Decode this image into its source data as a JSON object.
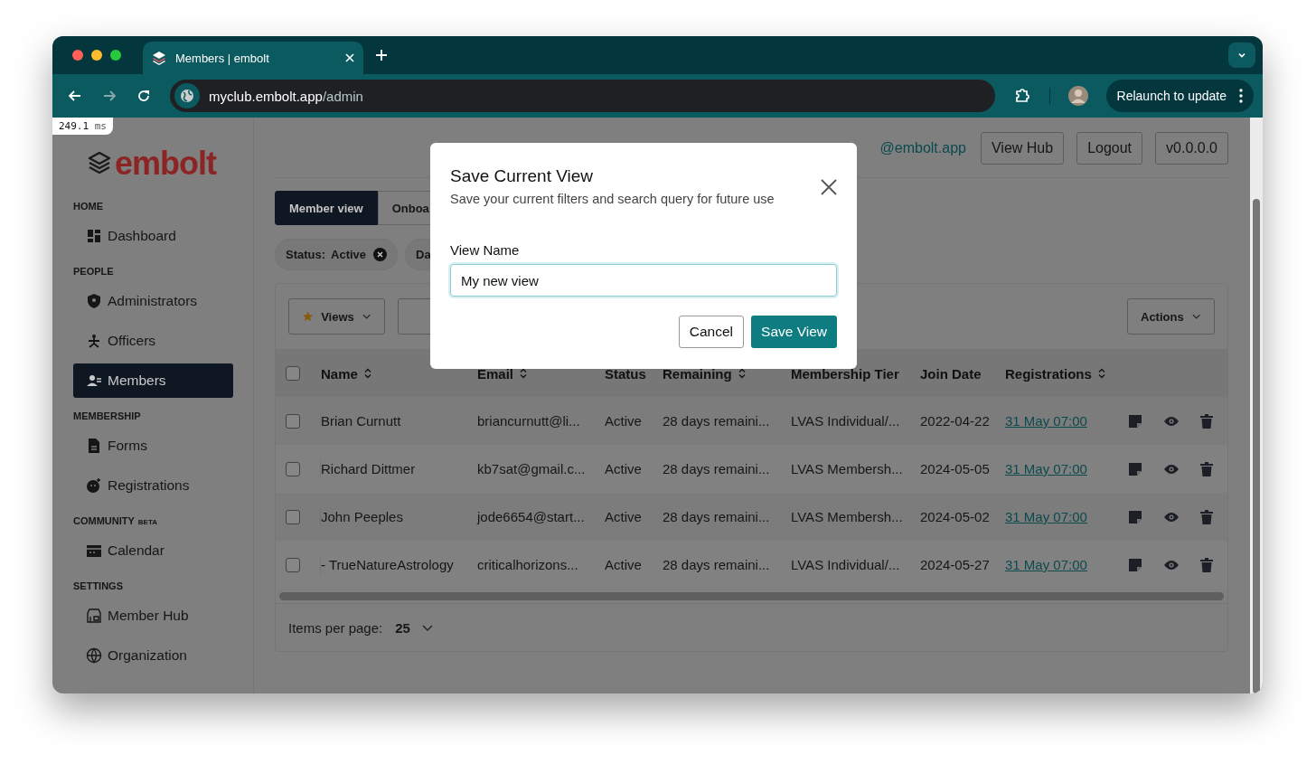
{
  "browser": {
    "tab_title": "Members | embolt",
    "url_host": "myclub.embolt.app",
    "url_path": "/admin",
    "relaunch_label": "Relaunch to update"
  },
  "perf_badge": {
    "value": "249.1",
    "unit": "ms"
  },
  "sidebar": {
    "logo": "embolt",
    "sections": [
      {
        "title": "HOME",
        "items": [
          {
            "label": "Dashboard",
            "selected": false
          }
        ]
      },
      {
        "title": "PEOPLE",
        "items": [
          {
            "label": "Administrators",
            "selected": false
          },
          {
            "label": "Officers",
            "selected": false
          },
          {
            "label": "Members",
            "selected": true
          }
        ]
      },
      {
        "title": "MEMBERSHIP",
        "items": [
          {
            "label": "Forms",
            "selected": false
          },
          {
            "label": "Registrations",
            "selected": false
          }
        ]
      },
      {
        "title": "COMMUNITY",
        "badge": "BETA",
        "items": [
          {
            "label": "Calendar",
            "selected": false
          }
        ]
      },
      {
        "title": "SETTINGS",
        "items": [
          {
            "label": "Member Hub",
            "selected": false
          },
          {
            "label": "Organization",
            "selected": false
          }
        ]
      }
    ]
  },
  "header": {
    "email": "@embolt.app",
    "buttons": [
      "View Hub",
      "Logout",
      "v0.0.0.0"
    ]
  },
  "view_tabs": [
    {
      "label": "Member view",
      "selected": true
    },
    {
      "label": "Onboa",
      "selected": false
    }
  ],
  "filters": [
    {
      "label": "Status:",
      "value": "Active"
    },
    {
      "label": "Da"
    }
  ],
  "toolbar": {
    "views": "Views",
    "actions": "Actions"
  },
  "table": {
    "select_all_checked": false,
    "columns": [
      {
        "label": "Name",
        "sortable": true
      },
      {
        "label": "Email",
        "sortable": true
      },
      {
        "label": "Status",
        "sortable": false
      },
      {
        "label": "Remaining",
        "sortable": true
      },
      {
        "label": "Membership Tier",
        "sortable": false
      },
      {
        "label": "Join Date",
        "sortable": false
      },
      {
        "label": "Registrations",
        "sortable": true
      }
    ],
    "rows": [
      {
        "checked": false,
        "cells": [
          "Brian Curnutt",
          "briancurnutt@li...",
          "Active",
          "28 days remaini...",
          "LVAS Individual/...",
          "2022-04-22",
          "31 May 07:00"
        ]
      },
      {
        "checked": false,
        "cells": [
          "Richard Dittmer",
          "kb7sat@gmail.c...",
          "Active",
          "28 days remaini...",
          "LVAS Membersh...",
          "2024-05-05",
          "31 May 07:00"
        ]
      },
      {
        "checked": false,
        "cells": [
          "John Peeples",
          "jode6654@start...",
          "Active",
          "28 days remaini...",
          "LVAS Membersh...",
          "2024-05-02",
          "31 May 07:00"
        ]
      },
      {
        "checked": false,
        "cells": [
          "- TrueNatureAstrology",
          "criticalhorizons...",
          "Active",
          "28 days remaini...",
          "LVAS Individual/...",
          "2024-05-27",
          "31 May 07:00"
        ]
      }
    ]
  },
  "pagination": {
    "label": "Items per page:",
    "value": "25"
  },
  "modal": {
    "title": "Save Current View",
    "subtitle": "Save your current filters and search query for future use",
    "field_label": "View Name",
    "field_value": "My new view",
    "cancel": "Cancel",
    "save": "Save View"
  }
}
